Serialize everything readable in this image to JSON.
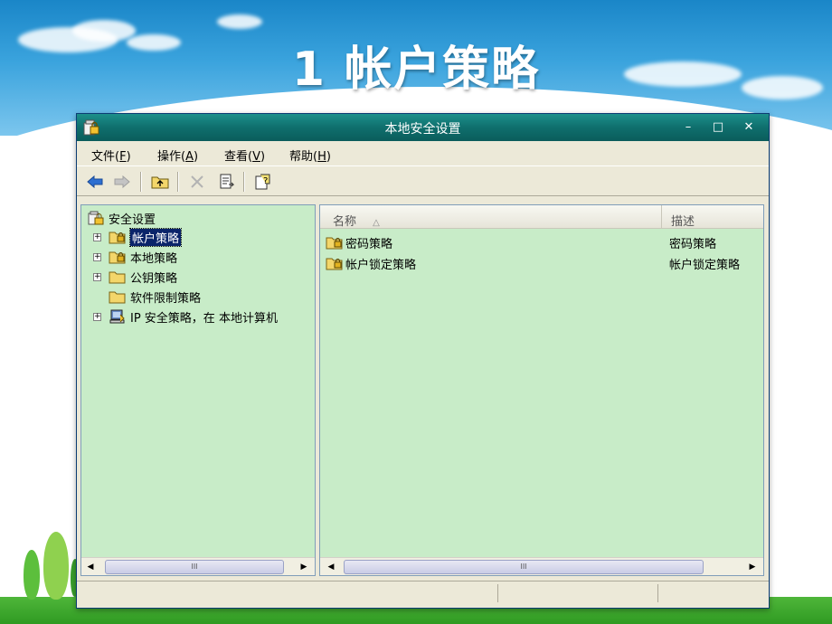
{
  "slide": {
    "title": "1   帐户策略"
  },
  "window": {
    "title": "本地安全设置",
    "controls": {
      "minimize": "–",
      "maximize": "□",
      "close": "✕"
    }
  },
  "menu": [
    {
      "label": "文件(",
      "key": "F",
      "suffix": ")"
    },
    {
      "label": "操作(",
      "key": "A",
      "suffix": ")"
    },
    {
      "label": "查看(",
      "key": "V",
      "suffix": ")"
    },
    {
      "label": "帮助(",
      "key": "H",
      "suffix": ")"
    }
  ],
  "toolbar": {
    "icons": [
      "back-arrow-icon",
      "forward-arrow-icon",
      "up-folder-icon",
      "delete-icon",
      "export-list-icon",
      "help-icon"
    ]
  },
  "tree": {
    "root": "安全设置",
    "items": [
      {
        "label": "帐户策略",
        "expander": "+",
        "selected": true
      },
      {
        "label": "本地策略",
        "expander": "+"
      },
      {
        "label": "公钥策略",
        "expander": "+"
      },
      {
        "label": "软件限制策略",
        "expander": ""
      },
      {
        "label": "IP 安全策略，在 本地计算机",
        "expander": "+"
      }
    ]
  },
  "list": {
    "columns": [
      "名称",
      "描述"
    ],
    "sort_indicator": "△",
    "rows": [
      {
        "name": "密码策略",
        "desc": "密码策略"
      },
      {
        "name": "帐户锁定策略",
        "desc": "帐户锁定策略"
      }
    ]
  },
  "scrollbar": {
    "left_arrow": "◀",
    "right_arrow": "▶",
    "thumb_grip": "III"
  },
  "colors": {
    "pane_bg": "#c8ecc8",
    "titlebar": "#0f6f6d",
    "selection": "#0a246a"
  }
}
